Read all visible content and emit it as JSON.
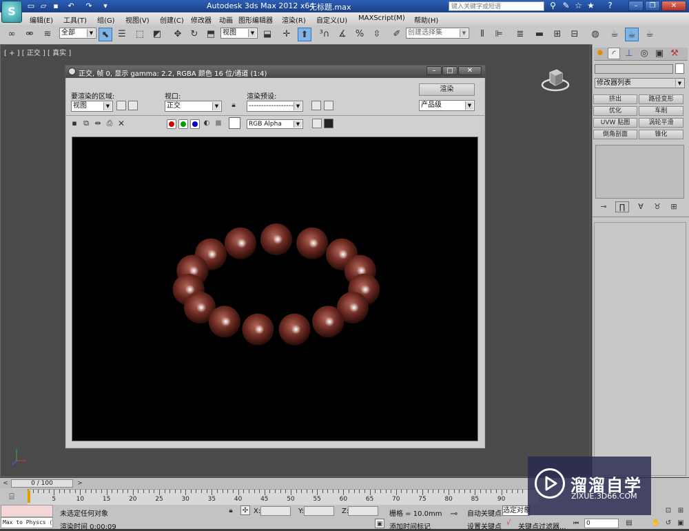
{
  "titlebar": {
    "app_title": "Autodesk 3ds Max  2012 x64",
    "file_name": "无标题.max",
    "search_placeholder": "键入关键字或短语",
    "logo_letter": "S"
  },
  "menubar": {
    "items": [
      "编辑(E)",
      "工具(T)",
      "组(G)",
      "视图(V)",
      "创建(C)",
      "修改器",
      "动画",
      "图形编辑器",
      "渲染(R)",
      "自定义(U)",
      "MAXScript(M)",
      "帮助(H)"
    ]
  },
  "toolbar": {
    "selection_filter": "全部",
    "ref_coord": "视图",
    "named_selection": "创建选择集"
  },
  "viewport": {
    "label": "[ + ] [ 正交 ] [ 真实 ]"
  },
  "render_window": {
    "title": "正交, 帧 0, 显示 gamma: 2.2, RGBA 颜色 16 位/通道 (1:4)",
    "area_label": "要渲染的区域:",
    "area_value": "视图",
    "viewport_label": "视口:",
    "viewport_value": "正交",
    "preset_label": "渲染预设:",
    "preset_value": "-------------------",
    "render_button": "渲染",
    "quality_value": "产品级",
    "channel_value": "RGB Alpha",
    "channel_colors": [
      "#d00000",
      "#00a000",
      "#0000d0"
    ]
  },
  "command_panel": {
    "modifier_list": "修改器列表",
    "buttons": [
      "挤出",
      "路径变形",
      "优化",
      "车削",
      "UVW 贴图",
      "涡轮平滑",
      "倒角剖面",
      "锥化"
    ]
  },
  "timeline": {
    "slider": "0 / 100",
    "ticks": [
      "5",
      "10",
      "15",
      "20",
      "25",
      "30",
      "35",
      "40",
      "45",
      "50",
      "55",
      "60",
      "65",
      "70",
      "75",
      "80",
      "85",
      "90"
    ]
  },
  "status": {
    "maxscript_line": "Max to Physcs (",
    "selection": "未选定任何对象",
    "render_time": "渲染时间  0:00:09",
    "x_label": "X:",
    "y_label": "Y:",
    "z_label": "Z:",
    "grid": "栅格 = 10.0mm",
    "add_tag": "添加时间标记",
    "auto_key": "自动关键点",
    "selected": "选定对象",
    "set_key": "设置关键点",
    "key_filter": "关键点过滤器...",
    "frame": "0"
  },
  "watermark": {
    "brand": "溜溜自学",
    "url": "ZIXUE.3D66.COM"
  },
  "colors": {
    "bead": "#6b2a22",
    "accent": "#2b5fb6"
  }
}
